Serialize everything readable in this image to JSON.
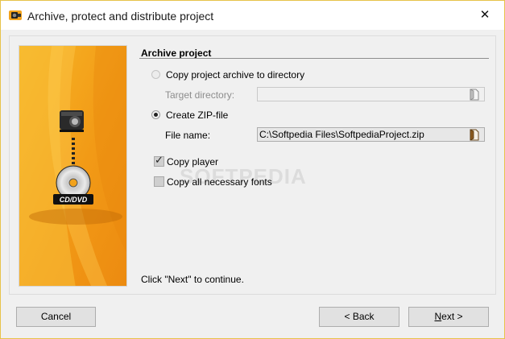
{
  "window": {
    "title": "Archive, protect and distribute project",
    "close_label": "✕"
  },
  "banner": {
    "disc_label": "CD/DVD",
    "icons": [
      "projector-icon",
      "cd-dvd-icon"
    ]
  },
  "section": {
    "title": "Archive project"
  },
  "options": {
    "archive_dir_label": "Copy project archive to directory",
    "archive_dir_selected": false,
    "target_dir_label": "Target directory:",
    "target_dir_value": "",
    "zip_label": "Create ZIP-file",
    "zip_selected": true,
    "file_name_label": "File name:",
    "file_name_value": "C:\\Softpedia Files\\SoftpediaProject.zip",
    "copy_player_label": "Copy player",
    "copy_player_checked": true,
    "copy_fonts_label": "Copy all necessary fonts",
    "copy_fonts_checked": false
  },
  "watermark": "SOFTPEDIA",
  "hint": "Click \"Next\" to continue.",
  "buttons": {
    "cancel": "Cancel",
    "back": "< Back",
    "next_underlined": "N",
    "next_rest": "ext >"
  },
  "colors": {
    "banner_orange": "#f2a21b",
    "window_border": "#e7c34a"
  }
}
